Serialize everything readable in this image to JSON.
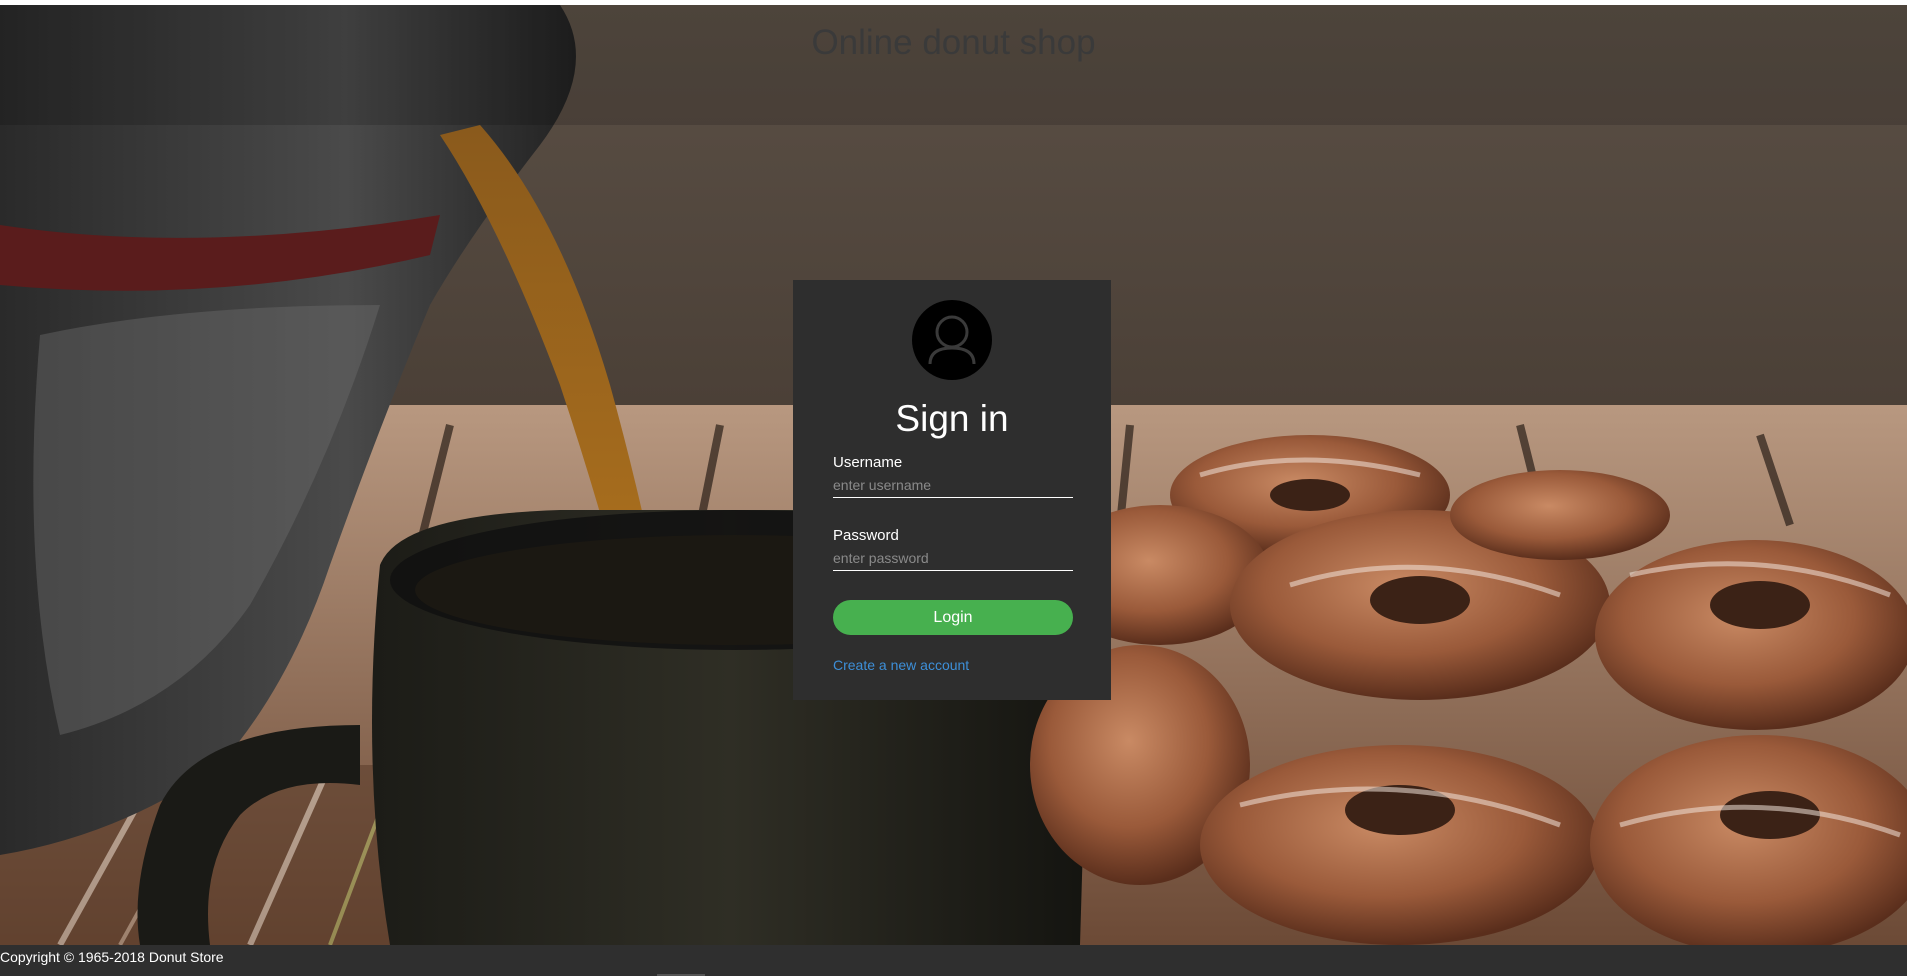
{
  "site": {
    "title": "Online donut shop"
  },
  "login": {
    "heading": "Sign in",
    "username_label": "Username",
    "username_placeholder": "enter username",
    "username_value": "",
    "password_label": "Password",
    "password_placeholder": "enter password",
    "password_value": "",
    "login_button_label": "Login",
    "create_account_link": "Create a new account",
    "avatar_icon": "user-icon"
  },
  "footer": {
    "copyright": "Copyright © 1965-2018 Donut Store"
  },
  "colors": {
    "login_box_background": "#2e2e2e",
    "login_button": "#47b04f",
    "link": "#3d8fd8",
    "footer_background": "#2f2f2f"
  }
}
